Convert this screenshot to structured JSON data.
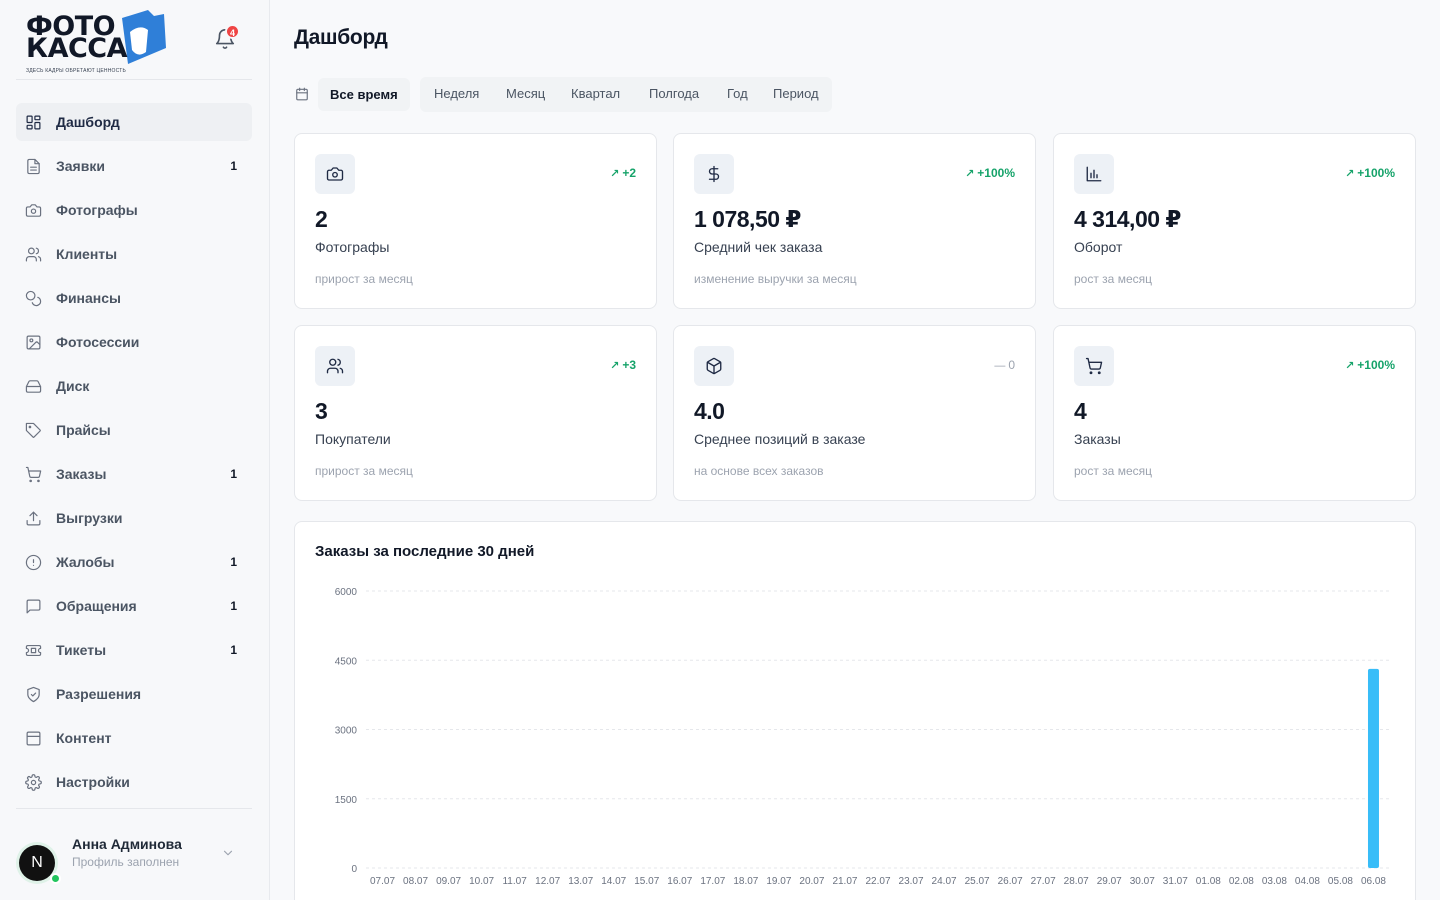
{
  "brand": {
    "line1": "ФОТО",
    "line2": "КАССА",
    "tagline": "ЗДЕСЬ КАДРЫ ОБРЕТАЮТ ЦЕННОСТЬ",
    "accent": "#2563eb"
  },
  "notifications": {
    "count": "4"
  },
  "sidebar": {
    "items": [
      {
        "label": "Дашборд",
        "count": "",
        "icon": "dashboard-icon",
        "active": true
      },
      {
        "label": "Заявки",
        "count": "1",
        "icon": "document-icon"
      },
      {
        "label": "Фотографы",
        "count": "",
        "icon": "camera-icon"
      },
      {
        "label": "Клиенты",
        "count": "",
        "icon": "users-icon"
      },
      {
        "label": "Финансы",
        "count": "",
        "icon": "coins-icon"
      },
      {
        "label": "Фотосессии",
        "count": "",
        "icon": "image-icon"
      },
      {
        "label": "Диск",
        "count": "",
        "icon": "hard-drive-icon"
      },
      {
        "label": "Прайсы",
        "count": "",
        "icon": "tag-icon"
      },
      {
        "label": "Заказы",
        "count": "1",
        "icon": "cart-icon"
      },
      {
        "label": "Выгрузки",
        "count": "",
        "icon": "upload-icon"
      },
      {
        "label": "Жалобы",
        "count": "1",
        "icon": "alert-circle-icon"
      },
      {
        "label": "Обращения",
        "count": "1",
        "icon": "message-icon"
      },
      {
        "label": "Тикеты",
        "count": "1",
        "icon": "ticket-icon"
      },
      {
        "label": "Разрешения",
        "count": "",
        "icon": "shield-icon"
      },
      {
        "label": "Контент",
        "count": "",
        "icon": "layout-icon"
      },
      {
        "label": "Настройки",
        "count": "",
        "icon": "gear-icon"
      }
    ]
  },
  "user": {
    "initial": "N",
    "name": "Анна Админова",
    "status": "Профиль заполнен"
  },
  "page": {
    "title": "Дашборд"
  },
  "periods": {
    "active": "Все время",
    "options": [
      "Неделя",
      "Месяц",
      "Квартал",
      "Полгода",
      "Год",
      "Период"
    ]
  },
  "cards": [
    {
      "icon": "camera-icon",
      "trend": "+2",
      "trend_dir": "up",
      "value": "2",
      "label": "Фотографы",
      "sub": "прирост за месяц"
    },
    {
      "icon": "dollar-icon",
      "trend": "+100%",
      "trend_dir": "up",
      "value": "1 078,50 ₽",
      "label": "Средний чек заказа",
      "sub": "изменение выручки за месяц"
    },
    {
      "icon": "bar-chart-icon",
      "trend": "+100%",
      "trend_dir": "up",
      "value": "4 314,00 ₽",
      "label": "Оборот",
      "sub": "рост за месяц"
    },
    {
      "icon": "users-icon",
      "trend": "+3",
      "trend_dir": "up",
      "value": "3",
      "label": "Покупатели",
      "sub": "прирост за месяц"
    },
    {
      "icon": "box-icon",
      "trend": "0",
      "trend_dir": "flat",
      "value": "4.0",
      "label": "Среднее позиций в заказе",
      "sub": "на основе всех заказов"
    },
    {
      "icon": "cart-icon",
      "trend": "+100%",
      "trend_dir": "up",
      "value": "4",
      "label": "Заказы",
      "sub": "рост за месяц"
    }
  ],
  "chart_title": "Заказы за последние 30 дней",
  "chart_data": {
    "type": "bar",
    "title": "Заказы за последние 30 дней",
    "xlabel": "",
    "ylabel": "",
    "ylim": [
      0,
      6000
    ],
    "yticks": [
      0,
      1500,
      3000,
      4500,
      6000
    ],
    "grid": true,
    "bar_color": "#38bdf8",
    "categories": [
      "07.07",
      "08.07",
      "09.07",
      "10.07",
      "11.07",
      "12.07",
      "13.07",
      "14.07",
      "15.07",
      "16.07",
      "17.07",
      "18.07",
      "19.07",
      "20.07",
      "21.07",
      "22.07",
      "23.07",
      "24.07",
      "25.07",
      "26.07",
      "27.07",
      "28.07",
      "29.07",
      "30.07",
      "31.07",
      "01.08",
      "02.08",
      "03.08",
      "04.08",
      "05.08",
      "06.08"
    ],
    "values": [
      0,
      0,
      0,
      0,
      0,
      0,
      0,
      0,
      0,
      0,
      0,
      0,
      0,
      0,
      0,
      0,
      0,
      0,
      0,
      0,
      0,
      0,
      0,
      0,
      0,
      0,
      0,
      0,
      0,
      0,
      4314
    ]
  }
}
